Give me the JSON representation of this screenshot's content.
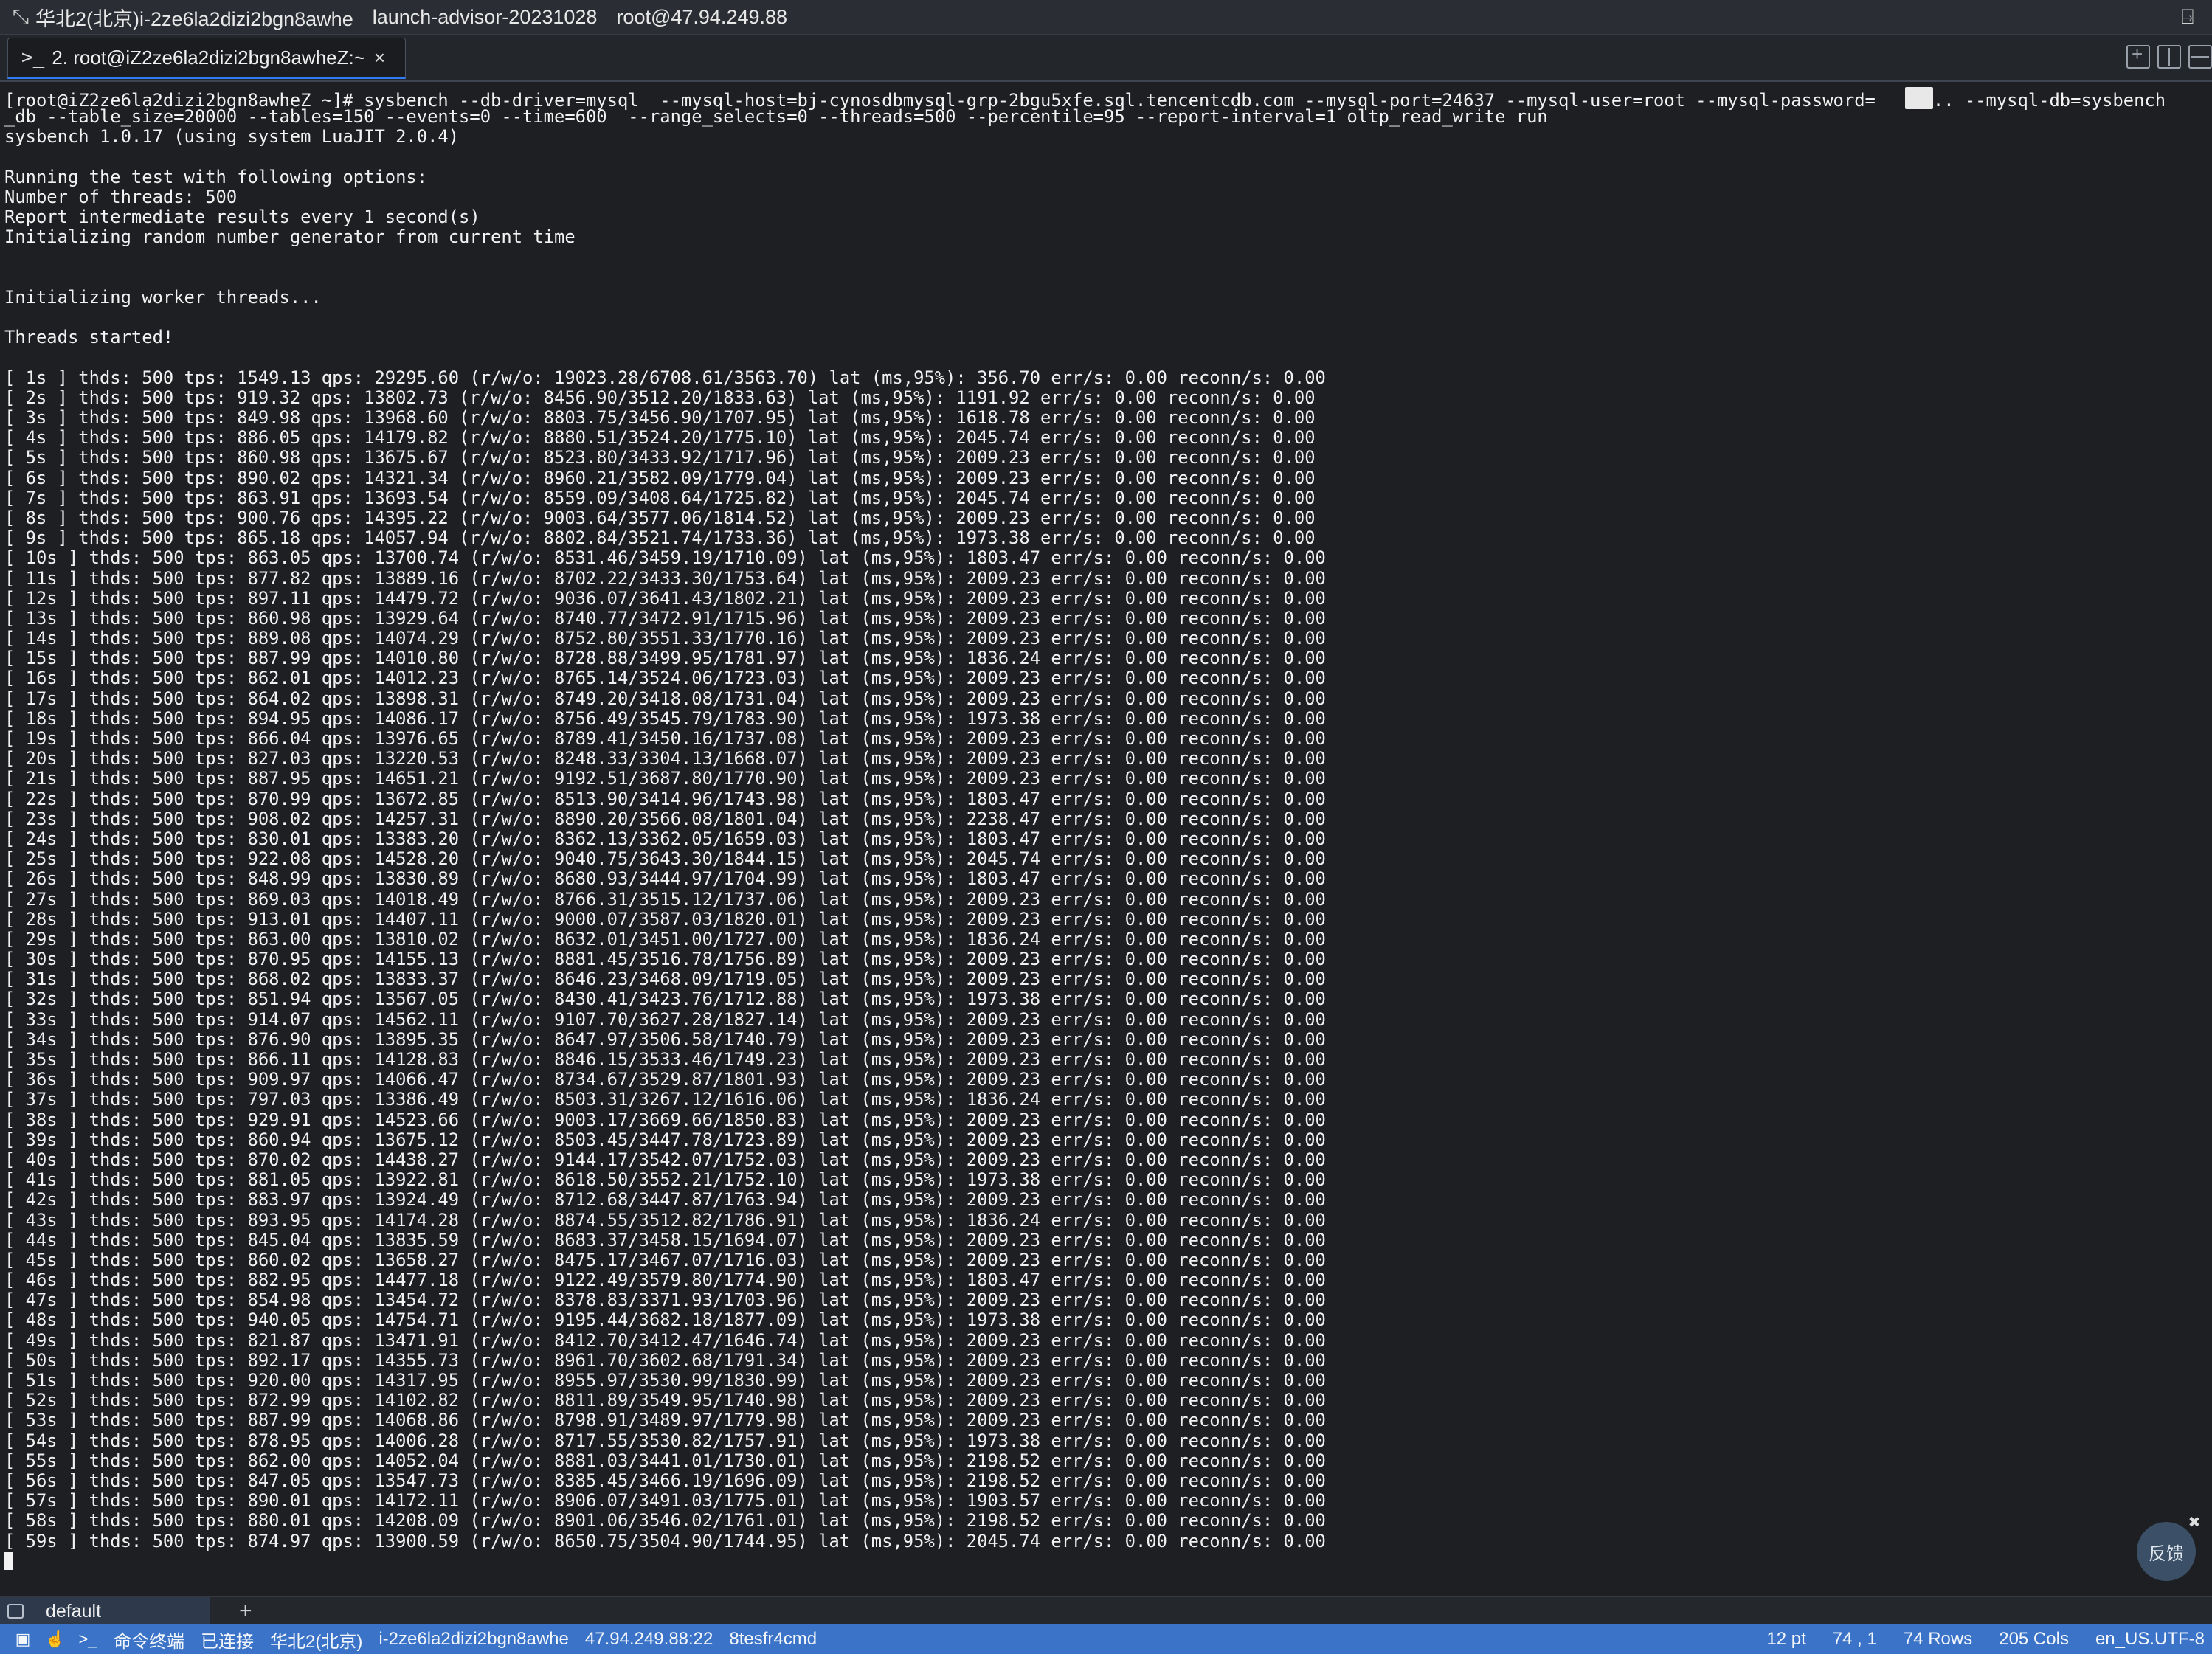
{
  "titlebar": {
    "region": "华北2(北京)i-2ze6la2dizi2bgn8awhe",
    "tab_name": "launch-advisor-20231028",
    "host": "root@47.94.249.88"
  },
  "tabbar": {
    "active_tab": "2. root@iZ2ze6la2dizi2bgn8awheZ:~"
  },
  "terminal": {
    "lines": [
      "[root@iZ2ze6la2dizi2bgn8awheZ ~]# sysbench --db-driver=mysql  --mysql-host=bj-cynosdbmysql-grp-2bgu5xfe.sql.tencentcdb.com --mysql-port=24637 --mysql-user=root --mysql-password=",
      "_db --table_size=20000 --tables=150 --events=0 --time=600  --range_selects=0 --threads=500 --percentile=95 --report-interval=1 oltp_read_write run",
      "sysbench 1.0.17 (using system LuaJIT 2.0.4)",
      "",
      "Running the test with following options:",
      "Number of threads: 500",
      "Report intermediate results every 1 second(s)",
      "Initializing random number generator from current time",
      "",
      "",
      "Initializing worker threads...",
      "",
      "Threads started!",
      "",
      "[ 1s ] thds: 500 tps: 1549.13 qps: 29295.60 (r/w/o: 19023.28/6708.61/3563.70) lat (ms,95%): 356.70 err/s: 0.00 reconn/s: 0.00",
      "[ 2s ] thds: 500 tps: 919.32 qps: 13802.73 (r/w/o: 8456.90/3512.20/1833.63) lat (ms,95%): 1191.92 err/s: 0.00 reconn/s: 0.00",
      "[ 3s ] thds: 500 tps: 849.98 qps: 13968.60 (r/w/o: 8803.75/3456.90/1707.95) lat (ms,95%): 1618.78 err/s: 0.00 reconn/s: 0.00",
      "[ 4s ] thds: 500 tps: 886.05 qps: 14179.82 (r/w/o: 8880.51/3524.20/1775.10) lat (ms,95%): 2045.74 err/s: 0.00 reconn/s: 0.00",
      "[ 5s ] thds: 500 tps: 860.98 qps: 13675.67 (r/w/o: 8523.80/3433.92/1717.96) lat (ms,95%): 2009.23 err/s: 0.00 reconn/s: 0.00",
      "[ 6s ] thds: 500 tps: 890.02 qps: 14321.34 (r/w/o: 8960.21/3582.09/1779.04) lat (ms,95%): 2009.23 err/s: 0.00 reconn/s: 0.00",
      "[ 7s ] thds: 500 tps: 863.91 qps: 13693.54 (r/w/o: 8559.09/3408.64/1725.82) lat (ms,95%): 2045.74 err/s: 0.00 reconn/s: 0.00",
      "[ 8s ] thds: 500 tps: 900.76 qps: 14395.22 (r/w/o: 9003.64/3577.06/1814.52) lat (ms,95%): 2009.23 err/s: 0.00 reconn/s: 0.00",
      "[ 9s ] thds: 500 tps: 865.18 qps: 14057.94 (r/w/o: 8802.84/3521.74/1733.36) lat (ms,95%): 1973.38 err/s: 0.00 reconn/s: 0.00",
      "[ 10s ] thds: 500 tps: 863.05 qps: 13700.74 (r/w/o: 8531.46/3459.19/1710.09) lat (ms,95%): 1803.47 err/s: 0.00 reconn/s: 0.00",
      "[ 11s ] thds: 500 tps: 877.82 qps: 13889.16 (r/w/o: 8702.22/3433.30/1753.64) lat (ms,95%): 2009.23 err/s: 0.00 reconn/s: 0.00",
      "[ 12s ] thds: 500 tps: 897.11 qps: 14479.72 (r/w/o: 9036.07/3641.43/1802.21) lat (ms,95%): 2009.23 err/s: 0.00 reconn/s: 0.00",
      "[ 13s ] thds: 500 tps: 860.98 qps: 13929.64 (r/w/o: 8740.77/3472.91/1715.96) lat (ms,95%): 2009.23 err/s: 0.00 reconn/s: 0.00",
      "[ 14s ] thds: 500 tps: 889.08 qps: 14074.29 (r/w/o: 8752.80/3551.33/1770.16) lat (ms,95%): 2009.23 err/s: 0.00 reconn/s: 0.00",
      "[ 15s ] thds: 500 tps: 887.99 qps: 14010.80 (r/w/o: 8728.88/3499.95/1781.97) lat (ms,95%): 1836.24 err/s: 0.00 reconn/s: 0.00",
      "[ 16s ] thds: 500 tps: 862.01 qps: 14012.23 (r/w/o: 8765.14/3524.06/1723.03) lat (ms,95%): 2009.23 err/s: 0.00 reconn/s: 0.00",
      "[ 17s ] thds: 500 tps: 864.02 qps: 13898.31 (r/w/o: 8749.20/3418.08/1731.04) lat (ms,95%): 2009.23 err/s: 0.00 reconn/s: 0.00",
      "[ 18s ] thds: 500 tps: 894.95 qps: 14086.17 (r/w/o: 8756.49/3545.79/1783.90) lat (ms,95%): 1973.38 err/s: 0.00 reconn/s: 0.00",
      "[ 19s ] thds: 500 tps: 866.04 qps: 13976.65 (r/w/o: 8789.41/3450.16/1737.08) lat (ms,95%): 2009.23 err/s: 0.00 reconn/s: 0.00",
      "[ 20s ] thds: 500 tps: 827.03 qps: 13220.53 (r/w/o: 8248.33/3304.13/1668.07) lat (ms,95%): 2009.23 err/s: 0.00 reconn/s: 0.00",
      "[ 21s ] thds: 500 tps: 887.95 qps: 14651.21 (r/w/o: 9192.51/3687.80/1770.90) lat (ms,95%): 2009.23 err/s: 0.00 reconn/s: 0.00",
      "[ 22s ] thds: 500 tps: 870.99 qps: 13672.85 (r/w/o: 8513.90/3414.96/1743.98) lat (ms,95%): 1803.47 err/s: 0.00 reconn/s: 0.00",
      "[ 23s ] thds: 500 tps: 908.02 qps: 14257.31 (r/w/o: 8890.20/3566.08/1801.04) lat (ms,95%): 2238.47 err/s: 0.00 reconn/s: 0.00",
      "[ 24s ] thds: 500 tps: 830.01 qps: 13383.20 (r/w/o: 8362.13/3362.05/1659.03) lat (ms,95%): 1803.47 err/s: 0.00 reconn/s: 0.00",
      "[ 25s ] thds: 500 tps: 922.08 qps: 14528.20 (r/w/o: 9040.75/3643.30/1844.15) lat (ms,95%): 2045.74 err/s: 0.00 reconn/s: 0.00",
      "[ 26s ] thds: 500 tps: 848.99 qps: 13830.89 (r/w/o: 8680.93/3444.97/1704.99) lat (ms,95%): 1803.47 err/s: 0.00 reconn/s: 0.00",
      "[ 27s ] thds: 500 tps: 869.03 qps: 14018.49 (r/w/o: 8766.31/3515.12/1737.06) lat (ms,95%): 2009.23 err/s: 0.00 reconn/s: 0.00",
      "[ 28s ] thds: 500 tps: 913.01 qps: 14407.11 (r/w/o: 9000.07/3587.03/1820.01) lat (ms,95%): 2009.23 err/s: 0.00 reconn/s: 0.00",
      "[ 29s ] thds: 500 tps: 863.00 qps: 13810.02 (r/w/o: 8632.01/3451.00/1727.00) lat (ms,95%): 1836.24 err/s: 0.00 reconn/s: 0.00",
      "[ 30s ] thds: 500 tps: 870.95 qps: 14155.13 (r/w/o: 8881.45/3516.78/1756.89) lat (ms,95%): 2009.23 err/s: 0.00 reconn/s: 0.00",
      "[ 31s ] thds: 500 tps: 868.02 qps: 13833.37 (r/w/o: 8646.23/3468.09/1719.05) lat (ms,95%): 2009.23 err/s: 0.00 reconn/s: 0.00",
      "[ 32s ] thds: 500 tps: 851.94 qps: 13567.05 (r/w/o: 8430.41/3423.76/1712.88) lat (ms,95%): 1973.38 err/s: 0.00 reconn/s: 0.00",
      "[ 33s ] thds: 500 tps: 914.07 qps: 14562.11 (r/w/o: 9107.70/3627.28/1827.14) lat (ms,95%): 2009.23 err/s: 0.00 reconn/s: 0.00",
      "[ 34s ] thds: 500 tps: 876.90 qps: 13895.35 (r/w/o: 8647.97/3506.58/1740.79) lat (ms,95%): 2009.23 err/s: 0.00 reconn/s: 0.00",
      "[ 35s ] thds: 500 tps: 866.11 qps: 14128.83 (r/w/o: 8846.15/3533.46/1749.23) lat (ms,95%): 2009.23 err/s: 0.00 reconn/s: 0.00",
      "[ 36s ] thds: 500 tps: 909.97 qps: 14066.47 (r/w/o: 8734.67/3529.87/1801.93) lat (ms,95%): 2009.23 err/s: 0.00 reconn/s: 0.00",
      "[ 37s ] thds: 500 tps: 797.03 qps: 13386.49 (r/w/o: 8503.31/3267.12/1616.06) lat (ms,95%): 1836.24 err/s: 0.00 reconn/s: 0.00",
      "[ 38s ] thds: 500 tps: 929.91 qps: 14523.66 (r/w/o: 9003.17/3669.66/1850.83) lat (ms,95%): 2009.23 err/s: 0.00 reconn/s: 0.00",
      "[ 39s ] thds: 500 tps: 860.94 qps: 13675.12 (r/w/o: 8503.45/3447.78/1723.89) lat (ms,95%): 2009.23 err/s: 0.00 reconn/s: 0.00",
      "[ 40s ] thds: 500 tps: 870.02 qps: 14438.27 (r/w/o: 9144.17/3542.07/1752.03) lat (ms,95%): 2009.23 err/s: 0.00 reconn/s: 0.00",
      "[ 41s ] thds: 500 tps: 881.05 qps: 13922.81 (r/w/o: 8618.50/3552.21/1752.10) lat (ms,95%): 1973.38 err/s: 0.00 reconn/s: 0.00",
      "[ 42s ] thds: 500 tps: 883.97 qps: 13924.49 (r/w/o: 8712.68/3447.87/1763.94) lat (ms,95%): 2009.23 err/s: 0.00 reconn/s: 0.00",
      "[ 43s ] thds: 500 tps: 893.95 qps: 14174.28 (r/w/o: 8874.55/3512.82/1786.91) lat (ms,95%): 1836.24 err/s: 0.00 reconn/s: 0.00",
      "[ 44s ] thds: 500 tps: 845.04 qps: 13835.59 (r/w/o: 8683.37/3458.15/1694.07) lat (ms,95%): 2009.23 err/s: 0.00 reconn/s: 0.00",
      "[ 45s ] thds: 500 tps: 860.02 qps: 13658.27 (r/w/o: 8475.17/3467.07/1716.03) lat (ms,95%): 2009.23 err/s: 0.00 reconn/s: 0.00",
      "[ 46s ] thds: 500 tps: 882.95 qps: 14477.18 (r/w/o: 9122.49/3579.80/1774.90) lat (ms,95%): 1803.47 err/s: 0.00 reconn/s: 0.00",
      "[ 47s ] thds: 500 tps: 854.98 qps: 13454.72 (r/w/o: 8378.83/3371.93/1703.96) lat (ms,95%): 2009.23 err/s: 0.00 reconn/s: 0.00",
      "[ 48s ] thds: 500 tps: 940.05 qps: 14754.71 (r/w/o: 9195.44/3682.18/1877.09) lat (ms,95%): 1973.38 err/s: 0.00 reconn/s: 0.00",
      "[ 49s ] thds: 500 tps: 821.87 qps: 13471.91 (r/w/o: 8412.70/3412.47/1646.74) lat (ms,95%): 2009.23 err/s: 0.00 reconn/s: 0.00",
      "[ 50s ] thds: 500 tps: 892.17 qps: 14355.73 (r/w/o: 8961.70/3602.68/1791.34) lat (ms,95%): 2009.23 err/s: 0.00 reconn/s: 0.00",
      "[ 51s ] thds: 500 tps: 920.00 qps: 14317.95 (r/w/o: 8955.97/3530.99/1830.99) lat (ms,95%): 2009.23 err/s: 0.00 reconn/s: 0.00",
      "[ 52s ] thds: 500 tps: 872.99 qps: 14102.82 (r/w/o: 8811.89/3549.95/1740.98) lat (ms,95%): 2009.23 err/s: 0.00 reconn/s: 0.00",
      "[ 53s ] thds: 500 tps: 887.99 qps: 14068.86 (r/w/o: 8798.91/3489.97/1779.98) lat (ms,95%): 2009.23 err/s: 0.00 reconn/s: 0.00",
      "[ 54s ] thds: 500 tps: 878.95 qps: 14006.28 (r/w/o: 8717.55/3530.82/1757.91) lat (ms,95%): 1973.38 err/s: 0.00 reconn/s: 0.00",
      "[ 55s ] thds: 500 tps: 862.00 qps: 14052.04 (r/w/o: 8881.03/3441.01/1730.01) lat (ms,95%): 2198.52 err/s: 0.00 reconn/s: 0.00",
      "[ 56s ] thds: 500 tps: 847.05 qps: 13547.73 (r/w/o: 8385.45/3466.19/1696.09) lat (ms,95%): 2198.52 err/s: 0.00 reconn/s: 0.00",
      "[ 57s ] thds: 500 tps: 890.01 qps: 14172.11 (r/w/o: 8906.07/3491.03/1775.01) lat (ms,95%): 1903.57 err/s: 0.00 reconn/s: 0.00",
      "[ 58s ] thds: 500 tps: 880.01 qps: 14208.09 (r/w/o: 8901.06/3546.02/1761.01) lat (ms,95%): 2198.52 err/s: 0.00 reconn/s: 0.00",
      "[ 59s ] thds: 500 tps: 874.97 qps: 13900.59 (r/w/o: 8650.75/3504.90/1744.95) lat (ms,95%): 2045.74 err/s: 0.00 reconn/s: 0.00"
    ],
    "first_line_suffix": ".. --mysql-db=sysbench"
  },
  "feedback": {
    "label": "反馈"
  },
  "session_bar": {
    "tab_label": "default",
    "add_label": "+"
  },
  "statusbar": {
    "terminal_label": "命令终端",
    "connection": "已连接",
    "region": "华北2(北京)",
    "instance": "i-2ze6la2dizi2bgn8awhe",
    "address": "47.94.249.88:22",
    "session_id": "8tesfr4cmd",
    "font_size": "12 pt",
    "cursor_pos": "74 , 1",
    "rows": "74 Rows",
    "cols": "205 Cols",
    "encoding": "en_US.UTF-8"
  },
  "colors": {
    "terminal_bg": "#1e1f22",
    "terminal_fg": "#f2f2f2",
    "statusbar_bg": "#3a73c7",
    "tab_accent": "#2f7cf6"
  }
}
